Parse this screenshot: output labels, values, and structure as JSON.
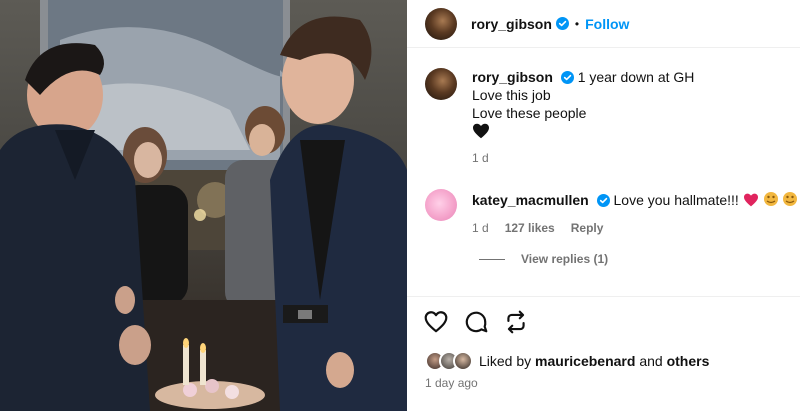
{
  "post": {
    "author": "rory_gibson",
    "follow_label": "Follow",
    "separator": "•"
  },
  "caption": {
    "author": "rory_gibson",
    "line1": "1 year down at GH",
    "line2": "Love this job",
    "line3": "Love these people",
    "emoji": "black-heart",
    "time": "1 d"
  },
  "reply_comment": {
    "author": "katey_macmullen",
    "text": "Love you hallmate!!!",
    "emojis": [
      "red-heart",
      "hands-emoji",
      "hands-emoji"
    ],
    "time": "1 d",
    "likes": "127 likes",
    "reply_label": "Reply",
    "view_replies": "View replies (1)"
  },
  "footer": {
    "liked_prefix": "Liked by",
    "liked_user": "mauricebenard",
    "liked_and": "and",
    "liked_others": "others",
    "timestamp": "1 day ago"
  },
  "colors": {
    "link_blue": "#0095f6",
    "verified_blue": "#0095f6",
    "muted": "#737373"
  },
  "icons": [
    "like-heart-icon",
    "comment-icon",
    "repost-icon",
    "verified-icon"
  ]
}
